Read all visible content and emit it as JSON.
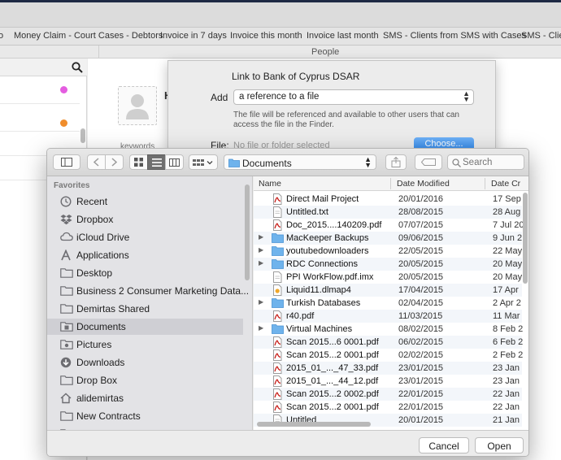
{
  "app": {
    "tabs": [
      "o",
      "Money Claim - Court Cases - Debtors",
      "Invoice in 7 days",
      "Invoice this month",
      "Invoice last month",
      "SMS - Clients from SMS with Cases",
      "SMS - Clie"
    ],
    "section_title": "People",
    "detail": {
      "keywords_label": "keywords",
      "name_fragment": "H"
    },
    "colors": {
      "pink_dot": "#e45de0",
      "orange_dot": "#f08d2c",
      "accent": "#2a85ea"
    }
  },
  "link_sheet": {
    "title": "Link to Bank of Cyprus DSAR",
    "add_label": "Add",
    "add_value": "a reference to a file",
    "hint": "The file will be referenced and available to other users that can access the file in the Finder.",
    "file_label": "File:",
    "file_value": "No file or folder selected",
    "choose_label": "Choose..."
  },
  "dialog": {
    "location": "Documents",
    "search_placeholder": "Search",
    "sidebar_heading": "Favorites",
    "sidebar": [
      {
        "label": "Recent",
        "icon": "clock-icon"
      },
      {
        "label": "Dropbox",
        "icon": "dropbox-icon"
      },
      {
        "label": "iCloud Drive",
        "icon": "cloud-icon"
      },
      {
        "label": "Applications",
        "icon": "applications-icon"
      },
      {
        "label": "Desktop",
        "icon": "folder-icon"
      },
      {
        "label": "Business 2 Consumer Marketing Data...",
        "icon": "folder-icon"
      },
      {
        "label": "Demirtas Shared",
        "icon": "folder-icon"
      },
      {
        "label": "Documents",
        "icon": "documents-icon"
      },
      {
        "label": "Pictures",
        "icon": "camera-icon"
      },
      {
        "label": "Downloads",
        "icon": "download-icon"
      },
      {
        "label": "Drop Box",
        "icon": "folder-icon"
      },
      {
        "label": "alidemirtas",
        "icon": "home-icon"
      },
      {
        "label": "New Contracts",
        "icon": "folder-icon"
      },
      {
        "label": "Dat",
        "icon": "folder-icon"
      }
    ],
    "columns": {
      "name": "Name",
      "modified": "Date Modified",
      "created": "Date Cr"
    },
    "files": [
      {
        "name": "Direct Mail Project",
        "modified": "20/01/2016",
        "created": "17 Sep",
        "type": "pdf",
        "folder": false
      },
      {
        "name": "Untitled.txt",
        "modified": "28/08/2015",
        "created": "28 Aug",
        "type": "doc",
        "folder": false
      },
      {
        "name": "Doc_2015....140209.pdf",
        "modified": "07/07/2015",
        "created": "7 Jul 20",
        "type": "pdf",
        "folder": false
      },
      {
        "name": "MacKeeper Backups",
        "modified": "09/06/2015",
        "created": "9 Jun 2",
        "type": "folder",
        "folder": true
      },
      {
        "name": "youtubedownloaders",
        "modified": "22/05/2015",
        "created": "22 May",
        "type": "folder",
        "folder": true
      },
      {
        "name": "RDC Connections",
        "modified": "20/05/2015",
        "created": "20 May",
        "type": "folder",
        "folder": true
      },
      {
        "name": "PPI WorkFlow.pdf.imx",
        "modified": "20/05/2015",
        "created": "20 May",
        "type": "doc",
        "folder": false
      },
      {
        "name": "Liquid11.dlmap4",
        "modified": "17/04/2015",
        "created": "17 Apr",
        "type": "map",
        "folder": false
      },
      {
        "name": "Turkish Databases",
        "modified": "02/04/2015",
        "created": "2 Apr 2",
        "type": "folder",
        "folder": true
      },
      {
        "name": "r40.pdf",
        "modified": "11/03/2015",
        "created": "11 Mar",
        "type": "pdf",
        "folder": false
      },
      {
        "name": "Virtual Machines",
        "modified": "08/02/2015",
        "created": "8 Feb 2",
        "type": "folder",
        "folder": true
      },
      {
        "name": "Scan 2015...6 0001.pdf",
        "modified": "06/02/2015",
        "created": "6 Feb 2",
        "type": "pdf",
        "folder": false
      },
      {
        "name": "Scan 2015...2 0001.pdf",
        "modified": "02/02/2015",
        "created": "2 Feb 2",
        "type": "pdf",
        "folder": false
      },
      {
        "name": "2015_01_..._47_33.pdf",
        "modified": "23/01/2015",
        "created": "23 Jan",
        "type": "pdf",
        "folder": false
      },
      {
        "name": "2015_01_..._44_12.pdf",
        "modified": "23/01/2015",
        "created": "23 Jan",
        "type": "pdf",
        "folder": false
      },
      {
        "name": "Scan 2015...2 0002.pdf",
        "modified": "22/01/2015",
        "created": "22 Jan",
        "type": "pdf",
        "folder": false
      },
      {
        "name": "Scan 2015...2 0001.pdf",
        "modified": "22/01/2015",
        "created": "22 Jan",
        "type": "pdf",
        "folder": false
      },
      {
        "name": "Untitled",
        "modified": "20/01/2015",
        "created": "21 Jan",
        "type": "doc",
        "folder": false
      }
    ],
    "cancel_label": "Cancel",
    "open_label": "Open"
  }
}
